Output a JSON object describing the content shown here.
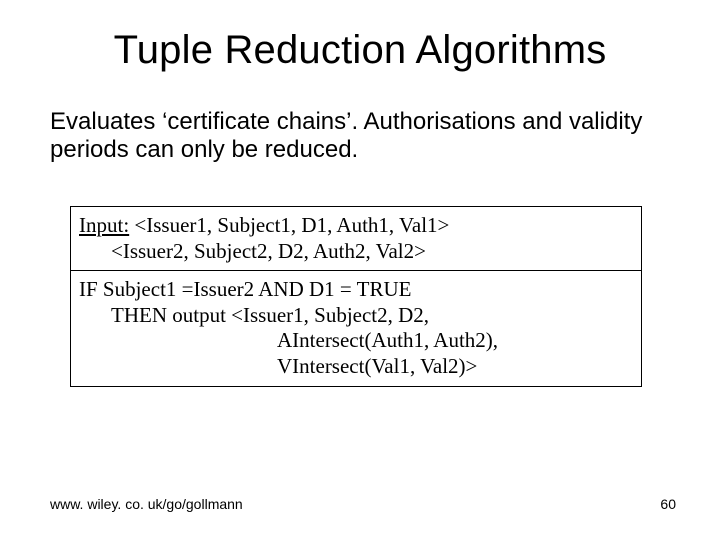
{
  "title": "Tuple Reduction Algorithms",
  "intro": "Evaluates ‘certificate chains’. Authorisations and validity periods can only be reduced.",
  "box": {
    "input_label": "Input:",
    "input_line1": " <Issuer1, Subject1, D1, Auth1, Val1>",
    "input_line2": "<Issuer2, Subject2, D2, Auth2, Val2>",
    "rule_line1": "IF Subject1 =Issuer2 AND D1 = TRUE",
    "rule_line2": "THEN output <Issuer1, Subject2, D2,",
    "rule_line3": "AIntersect(Auth1, Auth2),",
    "rule_line4": "VIntersect(Val1, Val2)>"
  },
  "footer": {
    "left": "www. wiley. co. uk/go/gollmann",
    "right": "60"
  }
}
